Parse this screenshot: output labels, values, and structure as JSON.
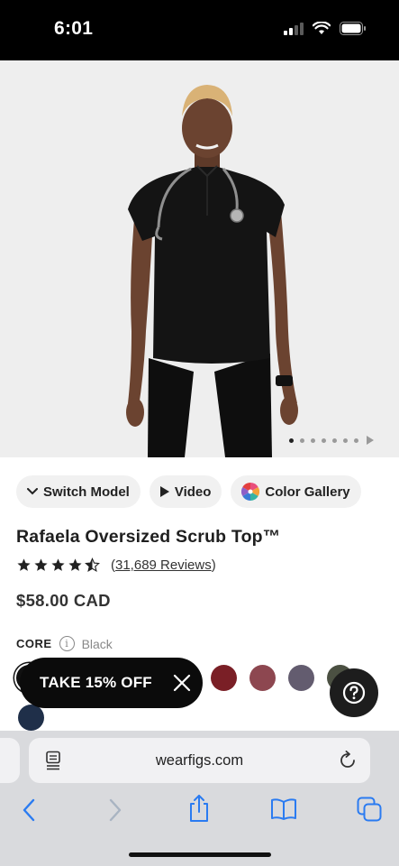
{
  "status": {
    "time": "6:01"
  },
  "carousel": {
    "dot_count": 8,
    "active_index": 0
  },
  "pills": {
    "switch_model": "Switch Model",
    "video": "Video",
    "color_gallery": "Color Gallery"
  },
  "product": {
    "title": "Rafaela Oversized Scrub Top™",
    "rating": 4.5,
    "reviews_prefix": "(",
    "reviews_count": "31,689 Reviews",
    "reviews_suffix": ")",
    "price": "$58.00 CAD"
  },
  "colors": {
    "collection": "CORE",
    "selected": "Black",
    "swatches": [
      "#111111",
      "#7a1f26",
      "#8d4750",
      "#635c6f",
      "#4b5042",
      "#1f2f49"
    ]
  },
  "promo": {
    "label": "TAKE 15% OFF"
  },
  "browser": {
    "url": "wearfigs.com"
  },
  "icons": {
    "signal": "signal-icon",
    "wifi": "wifi-icon",
    "battery": "battery-icon",
    "chevron": "chevron-down-icon",
    "play": "play-icon",
    "gallery": "color-wheel-icon",
    "star": "star-icon",
    "info": "info-icon",
    "close": "close-icon",
    "help": "question-icon",
    "reader": "reader-icon",
    "reload": "reload-icon",
    "back": "back-icon",
    "forward": "forward-icon",
    "share": "share-icon",
    "bookmarks": "bookmarks-icon",
    "tabs": "tabs-icon"
  }
}
